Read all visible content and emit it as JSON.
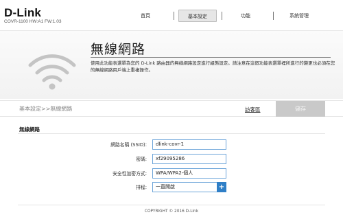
{
  "header": {
    "logo": "D-Link",
    "model": "COVR-1100 HW:A1 FW:1.03",
    "nav": [
      {
        "label": "首頁"
      },
      {
        "label": "基本設定"
      },
      {
        "label": "功能"
      },
      {
        "label": "系統管理"
      }
    ]
  },
  "banner": {
    "title": "無線網路",
    "description": "使用此功能表選單為您的 D-Link 路由器的無線網路設定進行組態設定。請注意在這個功能表選單裡所進行的變更也必須在您的無線網路用戶端上重複操作。",
    "icon": "wifi-icon"
  },
  "crumbbar": {
    "breadcrumb": "基本設定>>無線網路",
    "guest_link": "訪客區",
    "save_label": "儲存"
  },
  "section": {
    "title": "無線網路",
    "fields": [
      {
        "label": "網路名稱 (SSID):",
        "value": "dlink-covr-1"
      },
      {
        "label": "密碼:",
        "value": "xf29095286"
      },
      {
        "label": "安全性加密方式:",
        "value": "WPA/WPA2-個人"
      },
      {
        "label": "排程:",
        "value": "一直開啟",
        "button": "+"
      }
    ]
  },
  "footer": {
    "copyright": "COPYRIGHT © 2016 D-Link"
  }
}
